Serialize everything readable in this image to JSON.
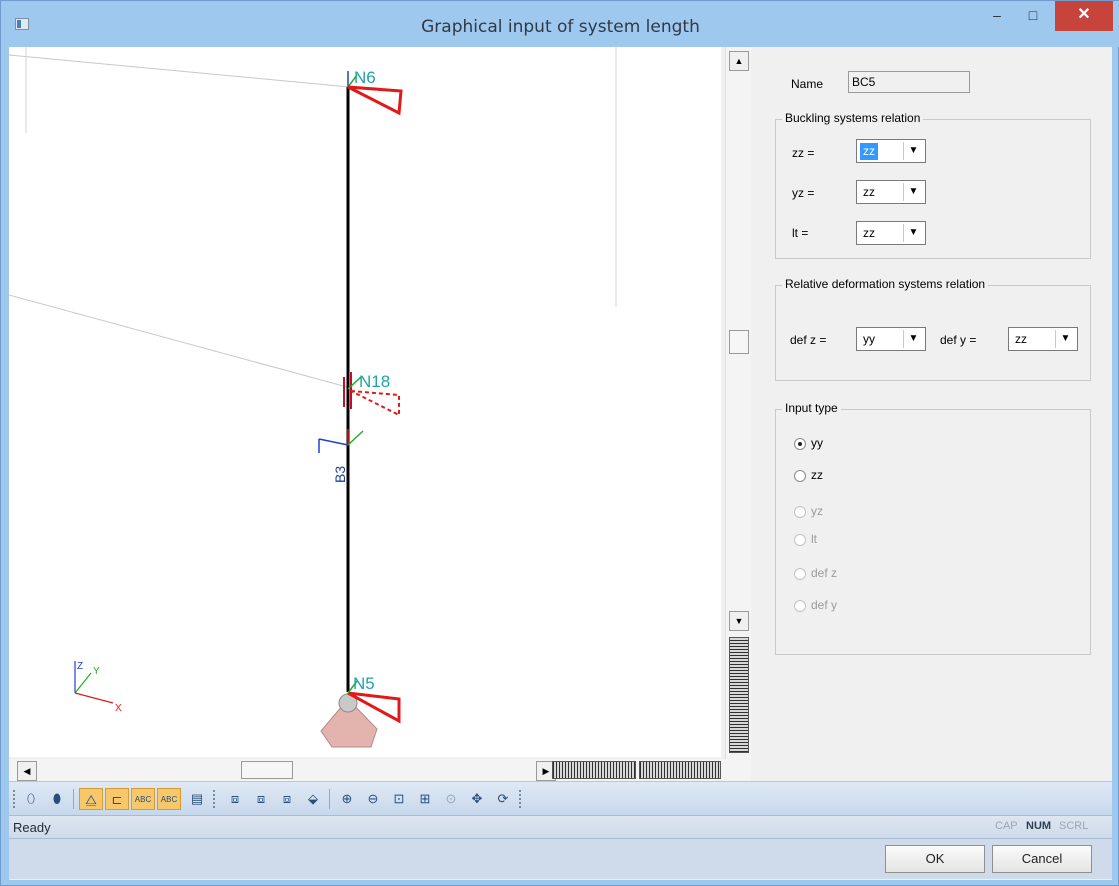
{
  "window": {
    "title": "Graphical input of system length",
    "controls": {
      "minimize": "–",
      "maximize": "□",
      "close": "✕"
    }
  },
  "viewport": {
    "nodes": [
      "N6",
      "N18",
      "N5"
    ],
    "beam_label": "B3",
    "axes_labels": {
      "z": "Z",
      "y": "Y",
      "x": "X"
    }
  },
  "panel": {
    "name_label": "Name",
    "name_value": "BC5",
    "buckling": {
      "title": "Buckling systems relation",
      "rows": [
        {
          "label": "zz =",
          "value": "zz",
          "selected": true
        },
        {
          "label": "yz =",
          "value": "zz",
          "selected": false
        },
        {
          "label": "lt  =",
          "value": "zz",
          "selected": false
        }
      ]
    },
    "deformation": {
      "title": "Relative deformation systems relation",
      "defz_label": "def z =",
      "defz_value": "yy",
      "defy_label": "def y =",
      "defy_value": "zz"
    },
    "input_type": {
      "title": "Input type",
      "options": [
        {
          "label": "yy",
          "checked": true,
          "enabled": true
        },
        {
          "label": "zz",
          "checked": false,
          "enabled": true
        },
        {
          "label": "yz",
          "checked": false,
          "enabled": false
        },
        {
          "label": "lt",
          "checked": false,
          "enabled": false
        },
        {
          "label": "def z",
          "checked": false,
          "enabled": false
        },
        {
          "label": "def y",
          "checked": false,
          "enabled": false
        }
      ]
    }
  },
  "status": {
    "text": "Ready",
    "indicators": [
      {
        "label": "CAP",
        "on": false
      },
      {
        "label": "NUM",
        "on": true
      },
      {
        "label": "SCRL",
        "on": false
      }
    ]
  },
  "buttons": {
    "ok": "OK",
    "cancel": "Cancel"
  },
  "colors": {
    "titlebar": "#9fc8ee",
    "close": "#c7443c",
    "accent_selection": "#3399ff",
    "node_label": "#1ea3a8",
    "beam_label": "#1c3f9e",
    "support": "#e01919"
  }
}
